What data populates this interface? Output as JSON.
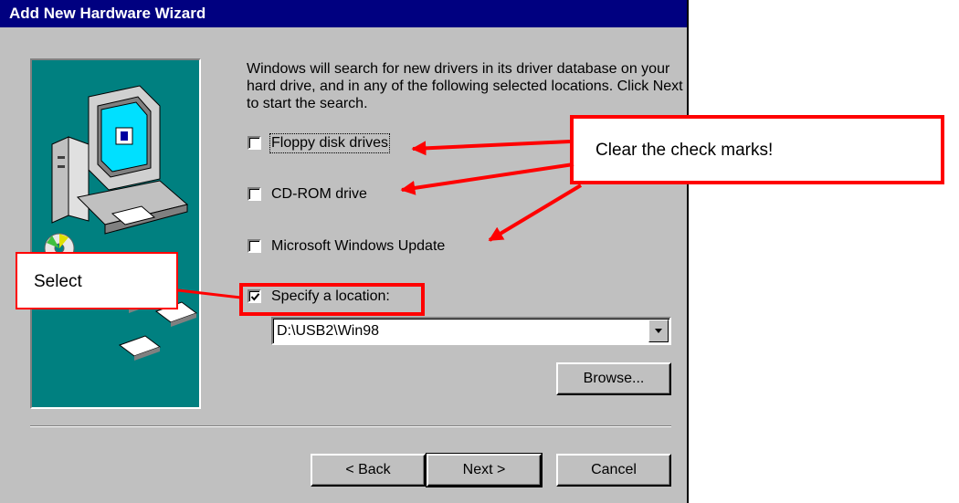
{
  "window": {
    "title": "Add New Hardware Wizard"
  },
  "intro_text": "Windows will search for new drivers in its driver database on your hard drive, and in any of the following selected locations. Click Next to start the search.",
  "options": [
    {
      "label": "Floppy disk drives",
      "checked": false
    },
    {
      "label": "CD-ROM drive",
      "checked": false
    },
    {
      "label": "Microsoft Windows Update",
      "checked": false
    },
    {
      "label": "Specify a location:",
      "checked": true
    }
  ],
  "location": {
    "value": "D:\\USB2\\Win98"
  },
  "buttons": {
    "browse": "Browse...",
    "back": "< Back",
    "next": "Next >",
    "cancel": "Cancel"
  },
  "annotations": {
    "clear": "Clear the check marks!",
    "select": "Select"
  },
  "colors": {
    "annotation": "#ff0000",
    "title_bar": "#000080",
    "dialog_face": "#c0c0c0",
    "illustration_bg": "#008080"
  }
}
